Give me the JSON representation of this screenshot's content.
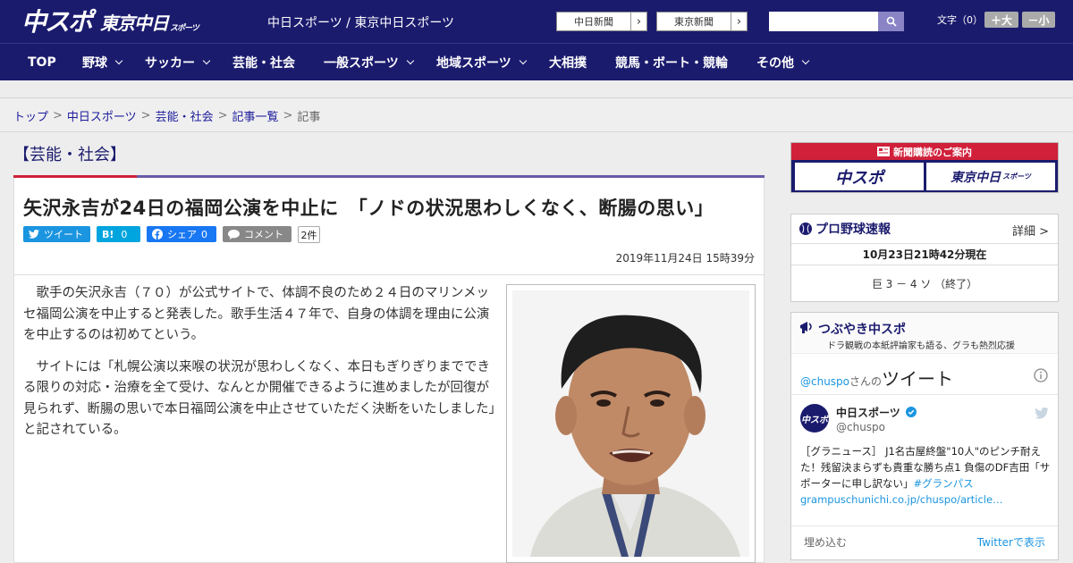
{
  "header": {
    "logo_chuspo": "中スポ",
    "logo_tokyo": "東京中日",
    "logo_tokyo_small": "スポーツ",
    "site_links": "中日スポーツ / 東京中日スポーツ",
    "btn_chunichi": "中日新聞",
    "btn_tokyo": "東京新聞",
    "search_placeholder": "",
    "font_label": "文字（0）",
    "font_plus": "＋大",
    "font_minus": "－小"
  },
  "nav": {
    "items": [
      {
        "label": "TOP"
      },
      {
        "label": "野球"
      },
      {
        "label": "サッカー"
      },
      {
        "label": "芸能・社会"
      },
      {
        "label": "一般スポーツ"
      },
      {
        "label": "地域スポーツ"
      },
      {
        "label": "大相撲"
      },
      {
        "label": "競馬・ボート・競輪"
      },
      {
        "label": "その他"
      }
    ]
  },
  "breadcrumb": {
    "items": [
      "トップ",
      "中日スポーツ",
      "芸能・社会",
      "記事一覧"
    ],
    "sep": ">",
    "current": "記事"
  },
  "article": {
    "category": "【芸能・社会】",
    "title": "矢沢永吉が24日の福岡公演を中止に　「ノドの状況思わしくなく、断腸の思い」",
    "share": {
      "tweet": "ツイート",
      "hatena": "B!",
      "hatena_count": "0",
      "facebook": "シェア",
      "facebook_count": "0",
      "comment": "コメント",
      "comment_count": "2件"
    },
    "date": "2019年11月24日 15時39分",
    "paragraphs": [
      "歌手の矢沢永吉（７０）が公式サイトで、体調不良のため２４日のマリンメッセ福岡公演を中止すると発表した。歌手生活４７年で、自身の体調を理由に公演を中止するのは初めてという。",
      "サイトには「札幌公演以来喉の状況が思わしくなく、本日もぎりぎりまでできる限りの対応・治療を全て受け、なんとか開催できるように進めましたが回復が見られず、断腸の思いで本日福岡公演を中止させていただく決断をいたしました」と記されている。"
    ]
  },
  "sidebar": {
    "ad_title": "新聞購読のご案内",
    "ad_chuspo": "中スポ",
    "ad_tokyo": "東京中日",
    "ad_tokyo_small": "スポーツ",
    "baseball": {
      "title": "プロ野球速報",
      "more": "詳細 >",
      "time": "10月23日21時42分現在",
      "score": "巨 3 － 4 ソ （終了）"
    },
    "tsubuyaki": {
      "title": "つぶやき中スポ",
      "subtitle": "ドラ観戦の本紙評論家も語る、グラも熱烈応援",
      "tweets_handle": "@chuspo",
      "tweets_san": "さんの",
      "tweets_word": "ツイート",
      "avatar_text": "中スポ",
      "name": "中日スポーツ",
      "handle": "@chuspo",
      "text": "［グラニュース］ J1名古屋終盤\"10人\"のピンチ耐えた！残留決まらずも貴重な勝ち点1 負傷のDF吉田「サポーターに申し訳ない」",
      "hashtag": "#グランパス",
      "link": "grampuschunichi.co.jp/chuspo/article…",
      "embed": "埋め込む",
      "view": "Twitterで表示"
    }
  },
  "colors": {
    "navy": "#1b1b6e",
    "accent_red": "#d0203a",
    "purple_line": "#6a5aa8",
    "twitter_blue": "#1b95e0"
  }
}
